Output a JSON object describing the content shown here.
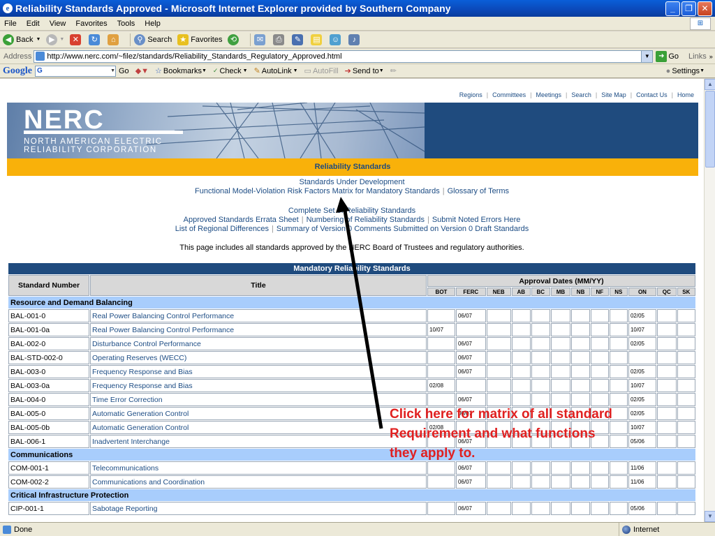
{
  "window": {
    "title": "Reliability Standards Approved - Microsoft Internet Explorer provided by Southern Company",
    "minimize": "_",
    "maximize": "❐",
    "close": "✕"
  },
  "menu": [
    "File",
    "Edit",
    "View",
    "Favorites",
    "Tools",
    "Help"
  ],
  "toolbar": {
    "back": "Back",
    "search": "Search",
    "favorites": "Favorites"
  },
  "address": {
    "label": "Address",
    "url": "http://www.nerc.com/~filez/standards/Reliability_Standards_Regulatory_Approved.html",
    "go": "Go",
    "links": "Links"
  },
  "google": {
    "logo": "Google",
    "search_prefix": "G",
    "go": "Go",
    "bookmarks": "Bookmarks",
    "check": "Check",
    "autolink": "AutoLink",
    "autofill": "AutoFill",
    "sendto": "Send to",
    "settings": "Settings"
  },
  "page": {
    "toplinks": [
      "Regions",
      "Committees",
      "Meetings",
      "Search",
      "Site Map",
      "Contact Us",
      "Home"
    ],
    "logo": "NERC",
    "logo_sub1": "NORTH AMERICAN ELECTRIC",
    "logo_sub2": "RELIABILITY CORPORATION",
    "section_title": "Reliability Standards",
    "links_row1": "Standards Under Development",
    "links_row2a": "Functional Model-Violation Risk Factors Matrix for Mandatory Standards",
    "links_row2b": "Glossary of Terms",
    "links_row3": "Complete Set of Reliability Standards",
    "links_row4a": "Approved Standards Errata Sheet",
    "links_row4b": "Numbering of Reliability Standards",
    "links_row4c": "Submit Noted Errors Here",
    "links_row5a": "List of Regional Differences",
    "links_row5b": "Summary of Version 0 Comments Submitted on Version 0 Draft Standards",
    "note": "This page includes all standards approved by the NERC Board of Trustees and regulatory authorities."
  },
  "table": {
    "caption": "Mandatory Reliability Standards",
    "col_number": "Standard Number",
    "col_title": "Title",
    "col_dates": "Approval Dates (MM/YY)",
    "date_cols": [
      "BOT",
      "FERC",
      "NEB",
      "AB",
      "BC",
      "MB",
      "NB",
      "NF",
      "NS",
      "ON",
      "QC",
      "SK"
    ],
    "groups": [
      {
        "name": "Resource and Demand Balancing",
        "rows": [
          {
            "num": "BAL-001-0",
            "title": "Real Power Balancing Control Performance",
            "dates": [
              "",
              "06/07",
              "",
              "",
              "",
              "",
              "",
              "",
              "",
              "02/05",
              "",
              ""
            ]
          },
          {
            "num": "BAL-001-0a",
            "title": "Real Power Balancing Control Performance",
            "dates": [
              "10/07",
              "",
              "",
              "",
              "",
              "",
              "",
              "",
              "",
              "10/07",
              "",
              ""
            ]
          },
          {
            "num": "BAL-002-0",
            "title": "Disturbance Control Performance",
            "dates": [
              "",
              "06/07",
              "",
              "",
              "",
              "",
              "",
              "",
              "",
              "02/05",
              "",
              ""
            ]
          },
          {
            "num": "BAL-STD-002-0",
            "title": "Operating Reserves (WECC)",
            "dates": [
              "",
              "06/07",
              "",
              "",
              "",
              "",
              "",
              "",
              "",
              "",
              "",
              ""
            ]
          },
          {
            "num": "BAL-003-0",
            "title": "Frequency Response and Bias",
            "dates": [
              "",
              "06/07",
              "",
              "",
              "",
              "",
              "",
              "",
              "",
              "02/05",
              "",
              ""
            ]
          },
          {
            "num": "BAL-003-0a",
            "title": "Frequency Response and Bias",
            "dates": [
              "02/08",
              "",
              "",
              "",
              "",
              "",
              "",
              "",
              "",
              "10/07",
              "",
              ""
            ]
          },
          {
            "num": "BAL-004-0",
            "title": "Time Error Correction",
            "dates": [
              "",
              "06/07",
              "",
              "",
              "",
              "",
              "",
              "",
              "",
              "02/05",
              "",
              ""
            ]
          },
          {
            "num": "BAL-005-0",
            "title": "Automatic Generation Control",
            "dates": [
              "",
              "06/07",
              "",
              "",
              "",
              "",
              "",
              "",
              "",
              "02/05",
              "",
              ""
            ]
          },
          {
            "num": "BAL-005-0b",
            "title": "Automatic Generation Control",
            "dates": [
              "02/08",
              "",
              "",
              "",
              "",
              "",
              "",
              "",
              "",
              "10/07",
              "",
              ""
            ]
          },
          {
            "num": "BAL-006-1",
            "title": "Inadvertent Interchange",
            "dates": [
              "",
              "06/07",
              "",
              "",
              "",
              "",
              "",
              "",
              "",
              "05/06",
              "",
              ""
            ]
          }
        ]
      },
      {
        "name": "Communications",
        "rows": [
          {
            "num": "COM-001-1",
            "title": "Telecommunications",
            "dates": [
              "",
              "06/07",
              "",
              "",
              "",
              "",
              "",
              "",
              "",
              "11/06",
              "",
              ""
            ]
          },
          {
            "num": "COM-002-2",
            "title": "Communications and Coordination",
            "dates": [
              "",
              "06/07",
              "",
              "",
              "",
              "",
              "",
              "",
              "",
              "11/06",
              "",
              ""
            ]
          }
        ]
      },
      {
        "name": "Critical Infrastructure Protection",
        "rows": [
          {
            "num": "CIP-001-1",
            "title": "Sabotage Reporting",
            "dates": [
              "",
              "06/07",
              "",
              "",
              "",
              "",
              "",
              "",
              "",
              "05/06",
              "",
              ""
            ]
          }
        ]
      }
    ]
  },
  "annotation": {
    "line1": "Click here for matrix of all standard",
    "line2": "Requirement and what functions",
    "line3": "they apply to."
  },
  "status": {
    "left": "Done",
    "zone": "Internet"
  },
  "colors": {
    "nerc_blue": "#1f4b7e",
    "nerc_yellow": "#f9b10a",
    "group_blue": "#a8cdfc",
    "annotation_red": "#e02020"
  }
}
